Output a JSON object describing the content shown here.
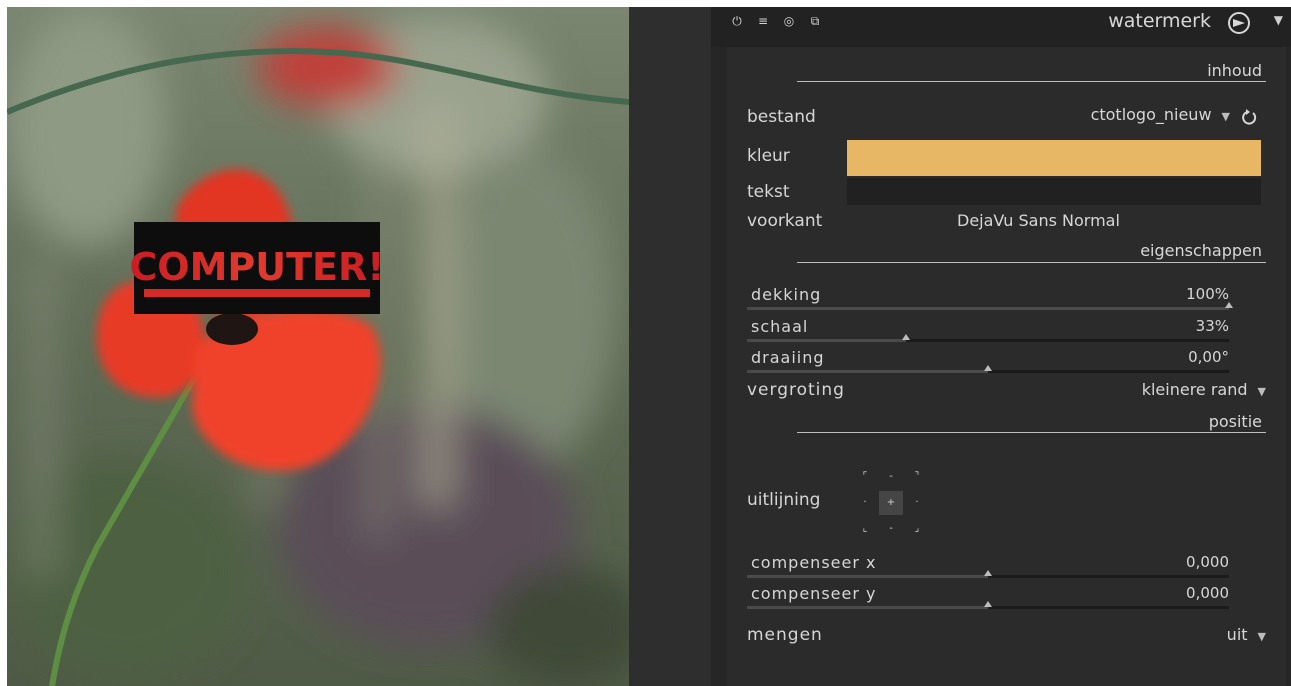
{
  "header": {
    "title": "watermerk",
    "icons": [
      "power-icon",
      "list-icon",
      "reset-circle-icon",
      "copy-icon"
    ]
  },
  "photo": {
    "watermark_text": "COMPUTER!"
  },
  "sections": {
    "content": "inhoud",
    "properties": "eigenschappen",
    "position": "positie"
  },
  "fields": {
    "file": {
      "label": "bestand",
      "value": "ctotlogo_nieuw"
    },
    "color": {
      "label": "kleur",
      "hex": "#e8b765"
    },
    "text": {
      "label": "tekst",
      "value": ""
    },
    "font": {
      "label": "voorkant",
      "value": "DejaVu Sans Normal"
    }
  },
  "sliders": [
    {
      "label": "dekking",
      "value": "100%",
      "fraction": 1.0
    },
    {
      "label": "schaal",
      "value": "33%",
      "fraction": 0.33
    },
    {
      "label": "draaiing",
      "value": "0,00°",
      "fraction": 0.5
    }
  ],
  "zoom": {
    "label": "vergroting",
    "value": "kleinere rand"
  },
  "alignment": {
    "label": "uitlijning",
    "selected": "center"
  },
  "offsets": [
    {
      "label": "compenseer x",
      "value": "0,000",
      "fraction": 0.5
    },
    {
      "label": "compenseer y",
      "value": "0,000",
      "fraction": 0.5
    }
  ],
  "blend": {
    "label": "mengen",
    "value": "uit"
  },
  "colors": {
    "panel_bg": "#2b2b2b",
    "swatch": "#e8b765"
  }
}
